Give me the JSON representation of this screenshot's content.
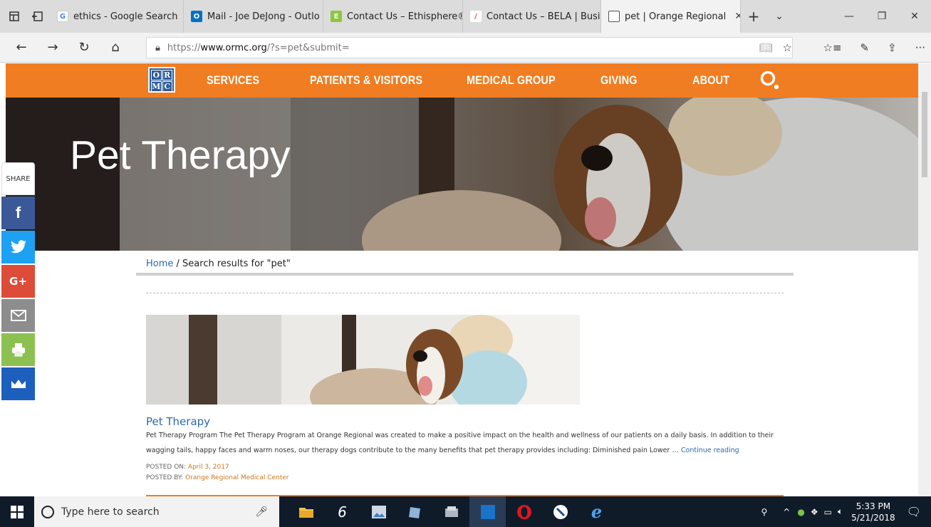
{
  "browser": {
    "tabs": [
      {
        "label": "ethics - Google Search",
        "favicon": "google-icon",
        "color": "#4285f4"
      },
      {
        "label": "Mail - Joe DeJong - Outlo",
        "favicon": "outlook-icon",
        "color": "#0072c6"
      },
      {
        "label": "Contact Us – Ethisphere®",
        "favicon": "ethisphere-icon",
        "color": "#8cc63f"
      },
      {
        "label": "Contact Us – BELA | Busin",
        "favicon": "bela-icon",
        "color": "#e84c3d"
      },
      {
        "label": "pet | Orange Regional",
        "favicon": "page-icon",
        "color": "#555555",
        "active": true
      }
    ],
    "url_prefix": "https://",
    "url_host": "www.ormc.org",
    "url_path": "/?s=pet&submit="
  },
  "site": {
    "brand_color": "#f07d21",
    "logo_letters": [
      "O",
      "R",
      "M",
      "C"
    ],
    "menu": [
      "SERVICES",
      "PATIENTS & VISITORS",
      "MEDICAL GROUP",
      "GIVING",
      "ABOUT"
    ],
    "hero_title": "Pet Therapy",
    "share": {
      "label": "SHARE",
      "facebook": "f",
      "googleplus": "G+"
    },
    "breadcrumb": {
      "home": "Home",
      "separator": " / ",
      "current": "Search results for \"pet\""
    },
    "result": {
      "title": "Pet Therapy",
      "excerpt": "Pet Therapy Program The Pet Therapy Program at Orange Regional was created to make a positive impact on the health and wellness of our patients on a daily basis. In addition to their wagging tails, happy faces and warm noses, our therapy dogs contribute to the many benefits that pet therapy provides including: Diminished pain Lower … ",
      "continue": "Continue reading",
      "posted_on_label": "POSTED ON: ",
      "posted_on": "April 3, 2017",
      "posted_by_label": "POSTED BY: ",
      "posted_by": "Orange Regional Medical Center"
    }
  },
  "taskbar": {
    "search_placeholder": "Type here to search",
    "time": "5:33 PM",
    "date": "5/21/2018"
  }
}
